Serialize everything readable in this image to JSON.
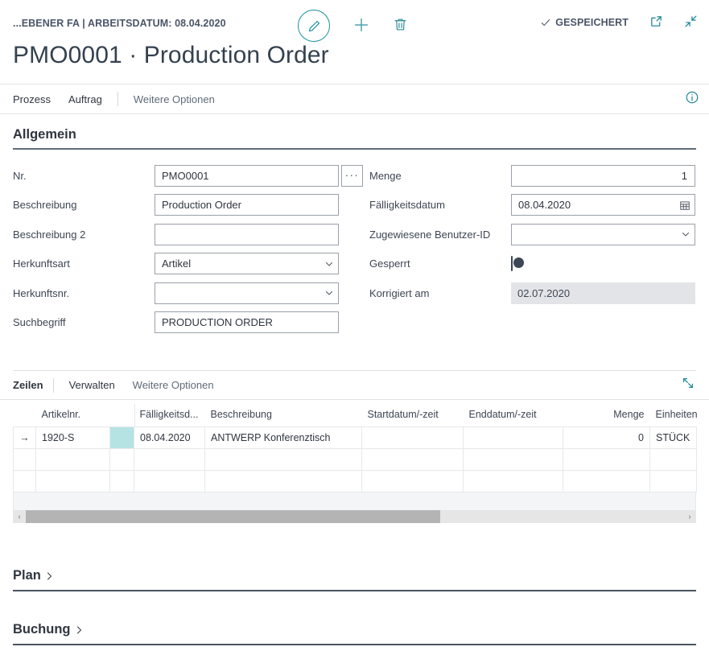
{
  "header": {
    "breadcrumb": "...EBENER FA | ARBEITSDATUM: 08.04.2020",
    "title": "PMO0001 · Production Order",
    "saved_label": "GESPEICHERT",
    "edit_icon": "pencil-icon",
    "new_icon": "plus-icon",
    "delete_icon": "trash-icon",
    "open_new_window_icon": "open-in-new-window-icon",
    "collapse_icon": "collapse-arrows-icon"
  },
  "ribbon": {
    "items": [
      {
        "label": "Prozess",
        "muted": false
      },
      {
        "label": "Auftrag",
        "muted": false
      },
      {
        "label": "Weitere Optionen",
        "muted": true
      }
    ],
    "info_icon": "info-icon"
  },
  "general": {
    "title": "Allgemein",
    "left_fields": [
      {
        "label": "Nr.",
        "value": "PMO0001",
        "type": "text",
        "assist": "···"
      },
      {
        "label": "Beschreibung",
        "value": "Production Order",
        "type": "text"
      },
      {
        "label": "Beschreibung 2",
        "value": "",
        "type": "text"
      },
      {
        "label": "Herkunftsart",
        "value": "Artikel",
        "type": "select"
      },
      {
        "label": "Herkunftsnr.",
        "value": "",
        "type": "select"
      },
      {
        "label": "Suchbegriff",
        "value": "PRODUCTION ORDER",
        "type": "text"
      }
    ],
    "right_fields": [
      {
        "label": "Menge",
        "value": "1",
        "type": "number"
      },
      {
        "label": "Fälligkeitsdatum",
        "value": "08.04.2020",
        "type": "date"
      },
      {
        "label": "Zugewiesene Benutzer-ID",
        "value": "",
        "type": "select"
      },
      {
        "label": "Gesperrt",
        "value": "off",
        "type": "toggle"
      },
      {
        "label": "Korrigiert am",
        "value": "02.07.2020",
        "type": "readonly"
      }
    ]
  },
  "lines": {
    "ribbon": [
      {
        "label": "Zeilen",
        "strong": true
      },
      {
        "label": "Verwalten",
        "strong": false
      },
      {
        "label": "Weitere Optionen",
        "strong": false
      }
    ],
    "expand_icon": "expand-grid-icon",
    "columns": [
      {
        "label": "",
        "align": "left"
      },
      {
        "label": "Artikelnr.",
        "align": "left"
      },
      {
        "label": "",
        "align": "left"
      },
      {
        "label": "Fälligkeitsd...",
        "align": "left"
      },
      {
        "label": "Beschreibung",
        "align": "left"
      },
      {
        "label": "Startdatum/-zeit",
        "align": "left"
      },
      {
        "label": "Enddatum/-zeit",
        "align": "left"
      },
      {
        "label": "Menge",
        "align": "right"
      },
      {
        "label": "Einheitenc",
        "align": "left"
      }
    ],
    "rows": [
      {
        "selected": true,
        "selector": "→",
        "artikelnr": "1920-S",
        "marker": "",
        "faelligkeitsdatum": "08.04.2020",
        "beschreibung": "ANTWERP Konferenztisch",
        "startdatum": "",
        "enddatum": "",
        "menge": "0",
        "einheitencode": "STÜCK"
      },
      {
        "selected": false,
        "selector": "",
        "artikelnr": "",
        "marker": "",
        "faelligkeitsdatum": "",
        "beschreibung": "",
        "startdatum": "",
        "enddatum": "",
        "menge": "",
        "einheitencode": ""
      },
      {
        "selected": false,
        "selector": "",
        "artikelnr": "",
        "marker": "",
        "faelligkeitsdatum": "",
        "beschreibung": "",
        "startdatum": "",
        "enddatum": "",
        "menge": "",
        "einheitencode": ""
      }
    ],
    "scroll": {
      "left_arrow": "‹",
      "right_arrow": "›",
      "thumb_percent": 63
    }
  },
  "sections": [
    {
      "title": "Plan",
      "chevron": "chevron-right-icon"
    },
    {
      "title": "Buchung",
      "chevron": "chevron-right-icon"
    }
  ],
  "colors": {
    "accent": "#0f7f8f",
    "text": "#2f3640",
    "highlight": "#b5e3e3",
    "readonly_bg": "#e3e4e7"
  }
}
